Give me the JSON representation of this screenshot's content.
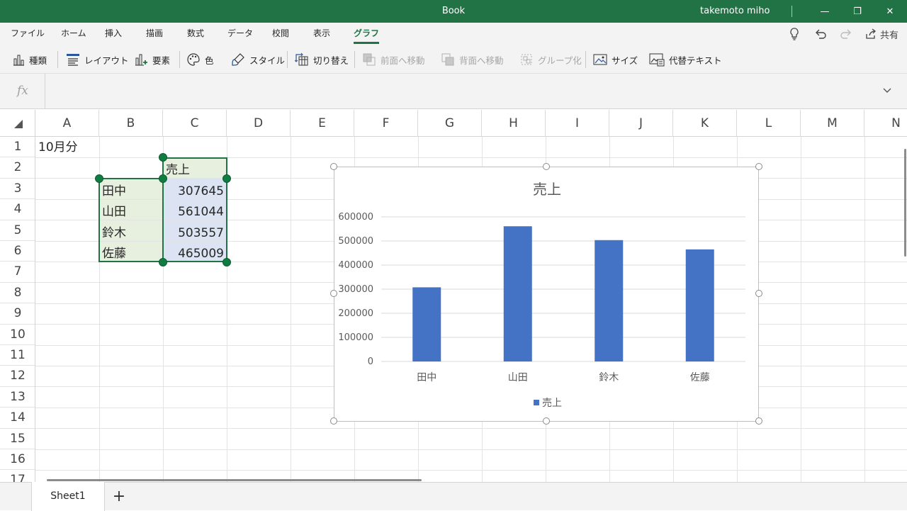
{
  "window": {
    "title": "Book",
    "user": "takemoto miho",
    "minimize": "—",
    "restore": "❐",
    "close": "✕"
  },
  "menu": {
    "tabs": [
      "ファイル",
      "ホーム",
      "挿入",
      "描画",
      "数式",
      "データ",
      "校閲",
      "表示",
      "グラフ"
    ],
    "active_tab": "グラフ",
    "share_label": "共有"
  },
  "ribbon": {
    "chart_type": "種類",
    "layout": "レイアウト",
    "elements": "要素",
    "color": "色",
    "style": "スタイル",
    "switch": "切り替え",
    "bring_forward": "前面へ移動",
    "send_backward": "背面へ移動",
    "group": "グループ化",
    "size": "サイズ",
    "alt_text": "代替テキスト"
  },
  "formula_bar": {
    "fx": "fx",
    "value": ""
  },
  "grid": {
    "columns": [
      "A",
      "B",
      "C",
      "D",
      "E",
      "F",
      "G",
      "H",
      "I",
      "J",
      "K",
      "L",
      "M",
      "N"
    ],
    "rows": [
      "1",
      "2",
      "3",
      "4",
      "5",
      "6",
      "7",
      "8",
      "9",
      "10",
      "11",
      "12",
      "13",
      "14",
      "15",
      "16",
      "17"
    ],
    "cells": {
      "a1": "10月分",
      "c2": "売上",
      "b3": "田中",
      "c3": "307645",
      "b4": "山田",
      "c4": "561044",
      "b5": "鈴木",
      "c5": "503557",
      "b6": "佐藤",
      "c6": "465009"
    }
  },
  "chart_data": {
    "type": "bar",
    "title": "売上",
    "categories": [
      "田中",
      "山田",
      "鈴木",
      "佐藤"
    ],
    "series": [
      {
        "name": "売上",
        "values": [
          307645,
          561044,
          503557,
          465009
        ],
        "color": "#4472c4"
      }
    ],
    "ylim": [
      0,
      600000
    ],
    "yticks": [
      "0",
      "100000",
      "200000",
      "300000",
      "400000",
      "500000",
      "600000"
    ],
    "grid": true,
    "legend": "bottom"
  },
  "sheets": {
    "tabs": [
      "Sheet1"
    ],
    "add": "+"
  }
}
